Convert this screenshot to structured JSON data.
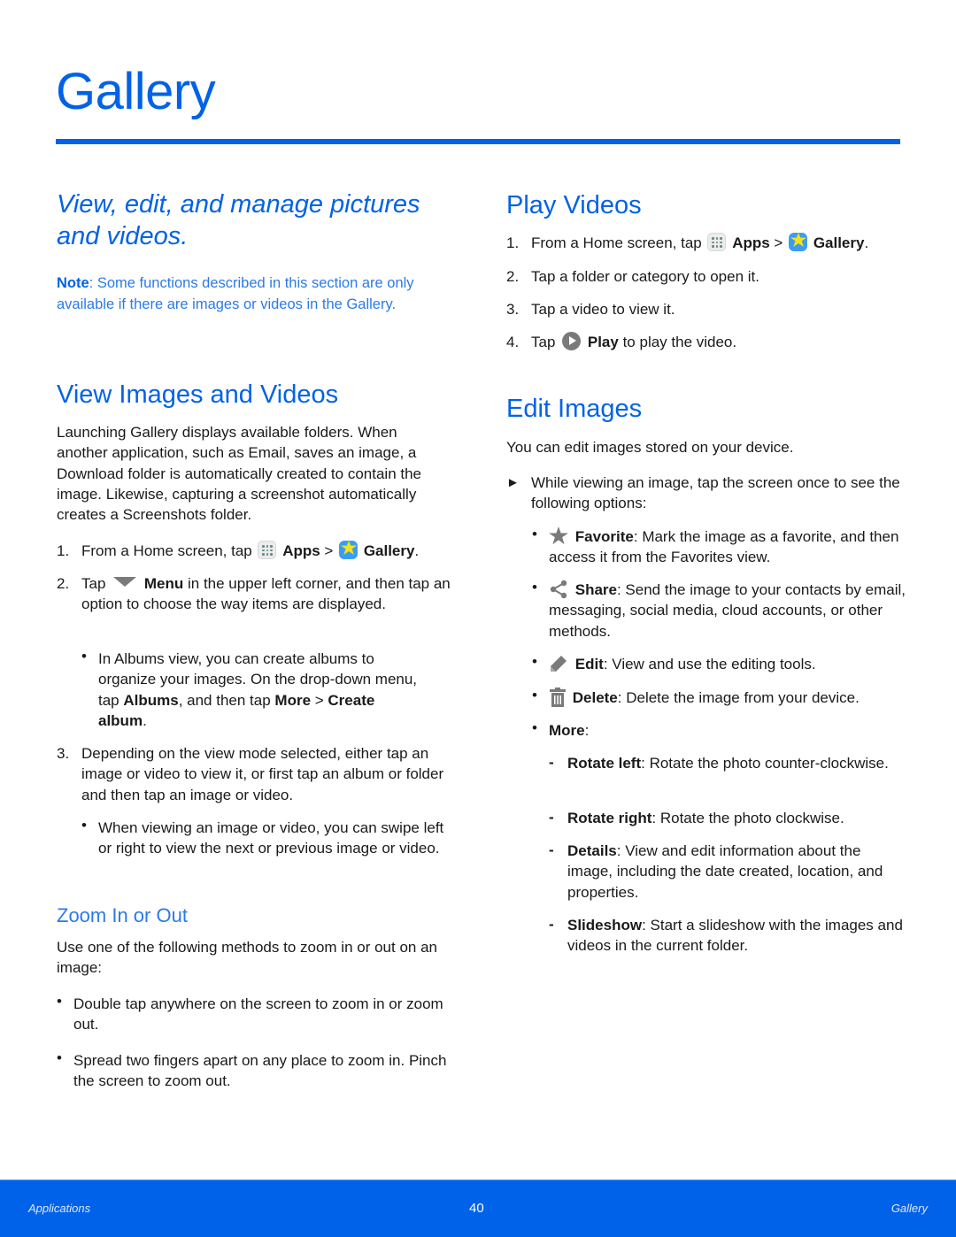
{
  "page": {
    "title": "Gallery",
    "intro": "View, edit, and manage pictures and videos.",
    "note": {
      "label": "Note",
      "text": ": Some functions described in this section are only available if there are images or videos in the Gallery."
    }
  },
  "view_images": {
    "heading": "View Images and Videos",
    "paragraph": "Launching Gallery displays available folders. When another application, such as Email, saves an image, a Download folder is automatically created to contain the image. Likewise, capturing a screenshot automatically creates a Screenshots folder.",
    "steps": [
      {
        "num": "1.",
        "pre": "From a Home screen, tap ",
        "apps_icon": "apps-icon",
        "apps_label": "Apps",
        "sep": " > ",
        "gallery_icon": "gallery-app-icon",
        "gallery_label": "Gallery",
        "post": "."
      },
      {
        "num": "2.",
        "pre": "Tap ",
        "icon": "menu-dropdown-icon",
        "bold": "Menu",
        "post": " in the upper left corner, and then tap an option to choose the way items are displayed.",
        "bullet": {
          "pre": "In Albums view, you can create albums to organize your images. On the drop-down menu, tap ",
          "bold1": "Albums",
          "mid": ", and then tap ",
          "bold2": "More",
          "sep": " > ",
          "bold3": "Create album",
          "post": "."
        }
      },
      {
        "num": "3.",
        "text": "Depending on the view mode selected, either tap an image or video to view it, or first tap an album or folder and then tap an image or video.",
        "bullet": "When viewing an image or video, you can swipe left or right to view the next or previous image or video."
      }
    ],
    "zoom": {
      "heading": "Zoom In or Out",
      "paragraph": "Use one of the following methods to zoom in or out on an image:",
      "bullets": [
        "Double tap anywhere on the screen to zoom in or zoom out.",
        "Spread two fingers apart on any place to zoom in. Pinch the screen to zoom out."
      ]
    }
  },
  "play_videos": {
    "heading": "Play Videos",
    "steps": [
      {
        "num": "1.",
        "pre": "From a Home screen, tap ",
        "apps_label": "Apps",
        "sep": " > ",
        "gallery_label": "Gallery",
        "post": "."
      },
      {
        "num": "2.",
        "text": "Tap a folder or category to open it."
      },
      {
        "num": "3.",
        "text": "Tap a video to view it."
      },
      {
        "num": "4.",
        "pre": "Tap ",
        "icon": "play-icon",
        "bold": "Play",
        "post": " to play the video."
      }
    ]
  },
  "edit_images": {
    "heading": "Edit Images",
    "paragraph": "You can edit images stored on your device.",
    "instruction_marker": "►",
    "instruction": "While viewing an image, tap the screen once to see the following options:",
    "options": [
      {
        "icon": "star-icon",
        "label": "Favorite",
        "text": ": Mark the image as a favorite, and then access it from the Favorites view."
      },
      {
        "icon": "share-icon",
        "label": "Share",
        "text": ": Send the image to your contacts by email, messaging, social media, cloud accounts, or other methods."
      },
      {
        "icon": "pencil-icon",
        "label": "Edit",
        "text": ": View and use the editing tools."
      },
      {
        "icon": "trash-icon",
        "label": "Delete",
        "text": ": Delete the image from your device."
      },
      {
        "label": "More",
        "text": ":"
      }
    ],
    "more_options": [
      {
        "label": "Rotate left",
        "text": ": Rotate the photo counter-clockwise."
      },
      {
        "label": "Rotate right",
        "text": ": Rotate the photo clockwise."
      },
      {
        "label": "Details",
        "text": ": View and edit information about the image, including the date created, location, and properties."
      },
      {
        "label": "Slideshow",
        "text": ": Start a slideshow with the images and videos in the current folder."
      }
    ]
  },
  "markers": {
    "bullet": "•",
    "dash": "-"
  },
  "footer": {
    "left": "Applications",
    "page_number": "40",
    "right": "Gallery"
  },
  "colors": {
    "accent": "#0062e8",
    "body_text": "#1a1a1a",
    "icon_gray": "#7a7a7a"
  }
}
